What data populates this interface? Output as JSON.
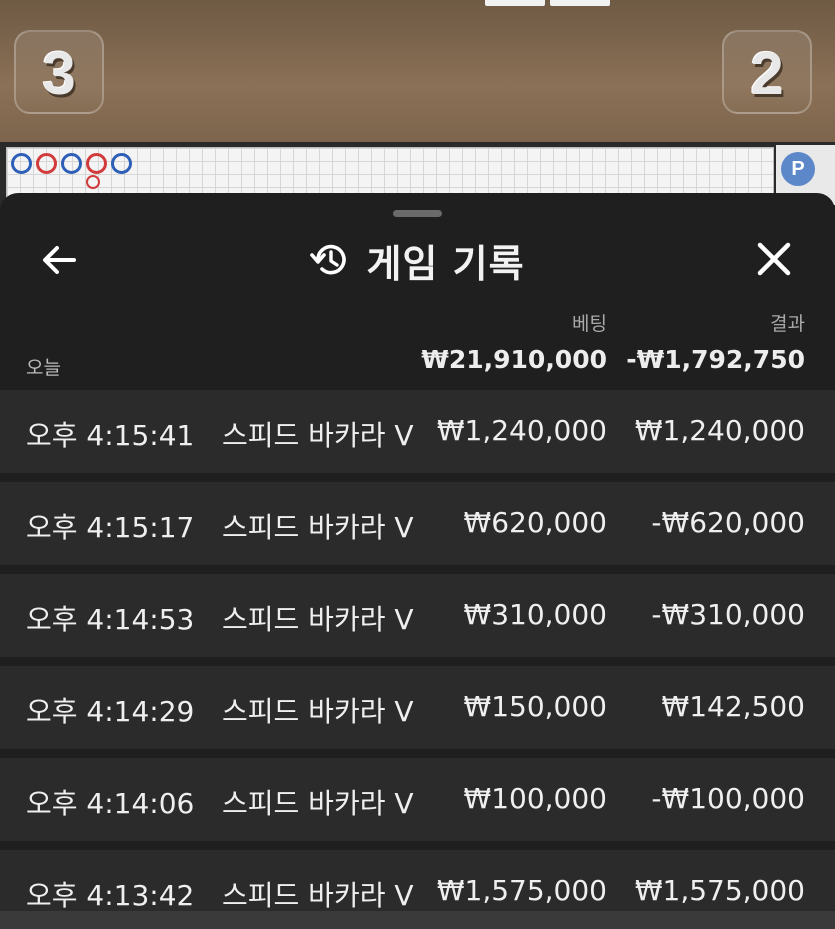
{
  "background": {
    "score_left": "3",
    "score_right": "2",
    "roadmap_beads": [
      "blue",
      "red",
      "blue",
      "red",
      "blue"
    ],
    "badge": "P"
  },
  "sheet": {
    "title": "게임 기록",
    "columns": {
      "bet": "베팅",
      "result": "결과"
    },
    "summary": {
      "label": "오늘",
      "total_bet": "₩21,910,000",
      "total_result": "-₩1,792,750"
    },
    "rows": [
      {
        "time": "오후 4:15:41",
        "game": "스피드 바카라 V",
        "bet": "₩1,240,000",
        "result": "₩1,240,000"
      },
      {
        "time": "오후 4:15:17",
        "game": "스피드 바카라 V",
        "bet": "₩620,000",
        "result": "-₩620,000"
      },
      {
        "time": "오후 4:14:53",
        "game": "스피드 바카라 V",
        "bet": "₩310,000",
        "result": "-₩310,000"
      },
      {
        "time": "오후 4:14:29",
        "game": "스피드 바카라 V",
        "bet": "₩150,000",
        "result": "₩142,500"
      },
      {
        "time": "오후 4:14:06",
        "game": "스피드 바카라 V",
        "bet": "₩100,000",
        "result": "-₩100,000"
      },
      {
        "time": "오후 4:13:42",
        "game": "스피드 바카라 V",
        "bet": "₩1,575,000",
        "result": "₩1,575,000"
      }
    ],
    "icons": {
      "back": "arrow-left-icon",
      "history": "history-icon",
      "close": "close-icon"
    }
  }
}
